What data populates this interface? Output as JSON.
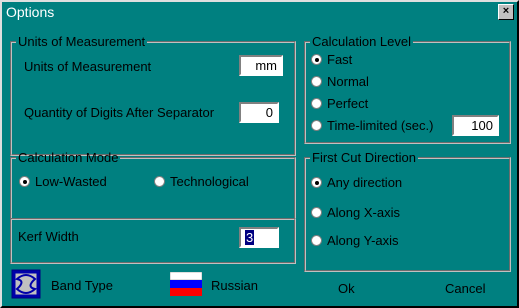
{
  "window": {
    "title": "Options",
    "close": "×"
  },
  "units": {
    "group": "Units of Measurement",
    "label": "Units of Measurement",
    "value": "mm",
    "digits_label": "Quantity of Digits After Separator",
    "digits_value": "0"
  },
  "calc_level": {
    "group": "Calculation Level",
    "options": [
      "Fast",
      "Normal",
      "Perfect",
      "Time-limited (sec.)"
    ],
    "selected": "Fast",
    "time_value": "100"
  },
  "calc_mode": {
    "group": "Calculation Mode",
    "options": [
      "Low-Wasted",
      "Technological"
    ],
    "selected": "Low-Wasted"
  },
  "first_cut": {
    "group": "First Cut Direction",
    "options": [
      "Any direction",
      "Along X-axis",
      "Along Y-axis"
    ],
    "selected": "Any direction"
  },
  "kerf": {
    "label": "Kerf Width",
    "value": "3"
  },
  "bottom": {
    "band_type": "Band Type",
    "language": "Russian",
    "ok": "Ok",
    "cancel": "Cancel"
  },
  "colors": {
    "background": "#008080",
    "flag_white": "#ffffff",
    "flag_blue": "#0000ff",
    "flag_red": "#ff0000"
  },
  "icons": [
    "close-icon",
    "band-type-icon",
    "russian-flag-icon"
  ]
}
